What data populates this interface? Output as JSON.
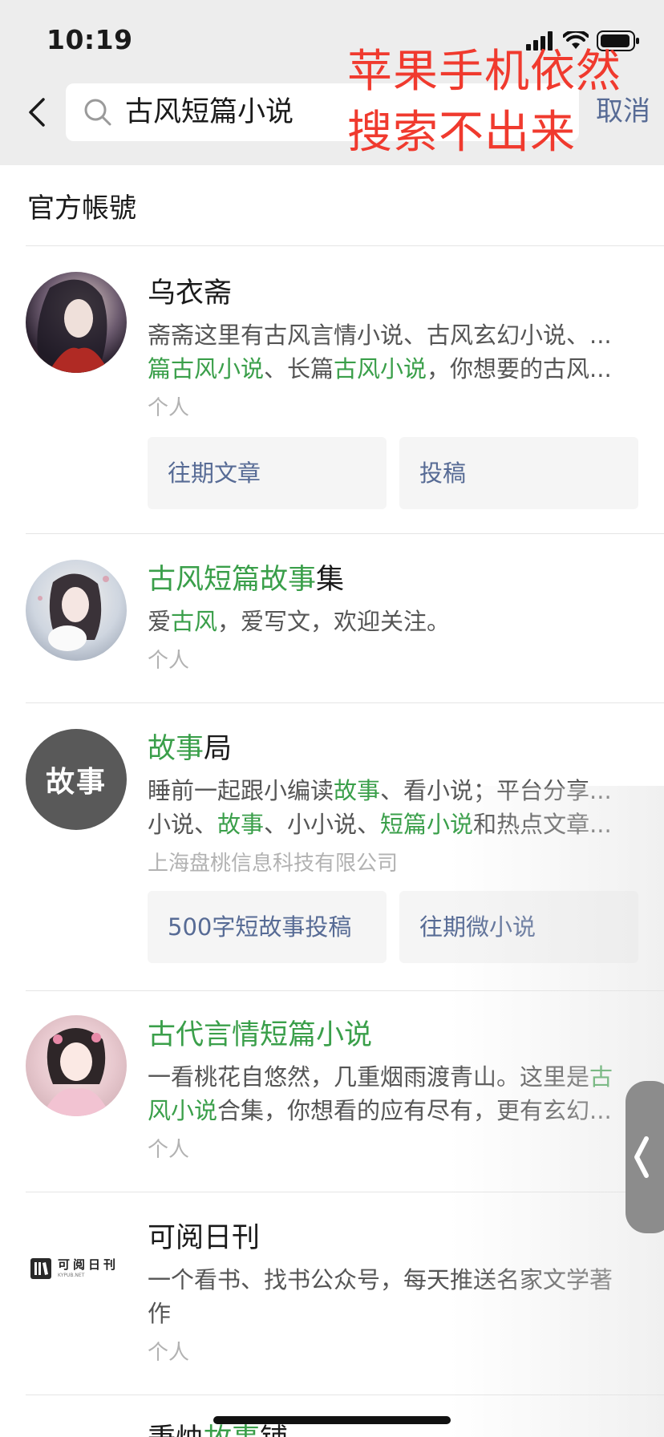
{
  "status_bar": {
    "time": "10:19"
  },
  "search": {
    "query": "古风短篇小说",
    "cancel_label": "取消"
  },
  "overlay_note": {
    "line1": "苹果手机依然",
    "line2": "搜索不出来"
  },
  "section_title": "官方帳號",
  "results": [
    {
      "name_parts": [
        {
          "text": "乌衣斋",
          "highlight": false
        }
      ],
      "desc_lines": [
        [
          {
            "text": "斋斋这里有古风言情小说、古风玄幻小说、...",
            "highlight": false
          }
        ],
        [
          {
            "text": "篇古风小说",
            "highlight": true
          },
          {
            "text": "、长篇",
            "highlight": false
          },
          {
            "text": "古风小说",
            "highlight": true
          },
          {
            "text": "，你想要的古风...",
            "highlight": false
          }
        ]
      ],
      "meta": "个人",
      "buttons": [
        "往期文章",
        "投稿"
      ]
    },
    {
      "name_parts": [
        {
          "text": "古风短篇故事",
          "highlight": true
        },
        {
          "text": "集",
          "highlight": false
        }
      ],
      "desc_lines": [
        [
          {
            "text": "爱",
            "highlight": false
          },
          {
            "text": "古风",
            "highlight": true
          },
          {
            "text": "，爱写文，欢迎关注。",
            "highlight": false
          }
        ]
      ],
      "meta": "个人",
      "buttons": []
    },
    {
      "name_parts": [
        {
          "text": "故事",
          "highlight": true
        },
        {
          "text": "局",
          "highlight": false
        }
      ],
      "avatar_text": "故事",
      "desc_lines": [
        [
          {
            "text": "睡前一起跟小编读",
            "highlight": false
          },
          {
            "text": "故事",
            "highlight": true
          },
          {
            "text": "、看小说；平台分享...",
            "highlight": false
          }
        ],
        [
          {
            "text": "小说、",
            "highlight": false
          },
          {
            "text": "故事",
            "highlight": true
          },
          {
            "text": "、小小说、",
            "highlight": false
          },
          {
            "text": "短篇小说",
            "highlight": true
          },
          {
            "text": "和热点文章...",
            "highlight": false
          }
        ]
      ],
      "meta": "上海盘桃信息科技有限公司",
      "buttons": [
        "500字短故事投稿",
        "往期微小说"
      ]
    },
    {
      "name_parts": [
        {
          "text": "古代言情短篇小说",
          "highlight": true
        }
      ],
      "desc_lines": [
        [
          {
            "text": "一看桃花自悠然，几重烟雨渡青山。这里是",
            "highlight": false
          },
          {
            "text": "古",
            "highlight": true
          }
        ],
        [
          {
            "text": "风小说",
            "highlight": true
          },
          {
            "text": "合集，你想看的应有尽有，更有玄幻...",
            "highlight": false
          }
        ]
      ],
      "meta": "个人",
      "buttons": []
    },
    {
      "name_parts": [
        {
          "text": "可阅日刊",
          "highlight": false
        }
      ],
      "logo_text": "可阅日刊",
      "logo_sub": "KYPUB.NET",
      "desc_lines": [
        [
          {
            "text": "一个看书、找书公众号，每天推送名家文学著",
            "highlight": false
          }
        ],
        [
          {
            "text": "作",
            "highlight": false
          }
        ]
      ],
      "meta": "个人",
      "buttons": []
    },
    {
      "name_parts": [
        {
          "text": "秉烛",
          "highlight": false
        },
        {
          "text": "故事",
          "highlight": true
        },
        {
          "text": "铺",
          "highlight": false
        }
      ]
    }
  ]
}
